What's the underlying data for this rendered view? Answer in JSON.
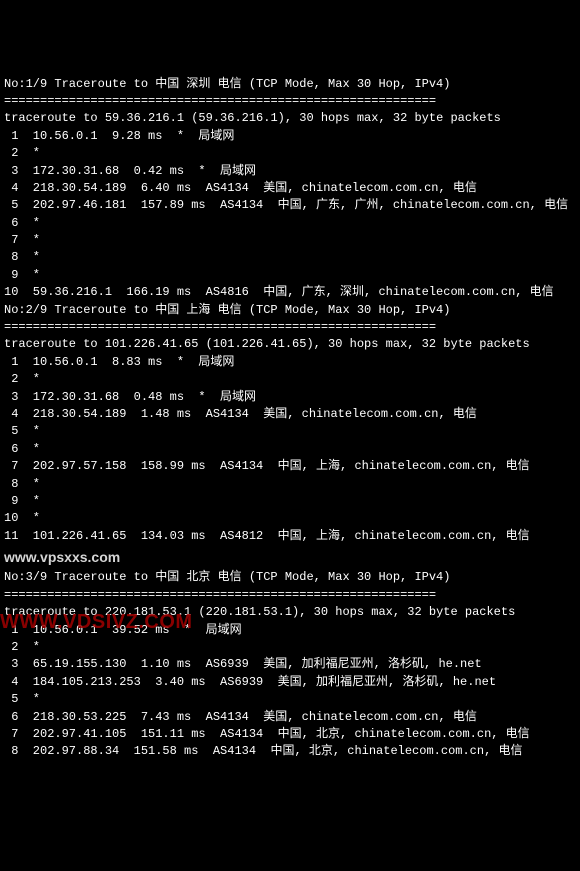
{
  "sep": "============================================================",
  "watermark1": "www.vpsxxs.com",
  "watermark2": "WWW.VDSIVZ.COM",
  "traces": [
    {
      "title": "No:1/9 Traceroute to 中国 深圳 电信 (TCP Mode, Max 30 Hop, IPv4)",
      "header": "traceroute to 59.36.216.1 (59.36.216.1), 30 hops max, 32 byte packets",
      "hops": [
        " 1  10.56.0.1  9.28 ms  *  局域网",
        " 2  *",
        " 3  172.30.31.68  0.42 ms  *  局域网",
        " 4  218.30.54.189  6.40 ms  AS4134  美国, chinatelecom.com.cn, 电信",
        " 5  202.97.46.181  157.89 ms  AS4134  中国, 广东, 广州, chinatelecom.com.cn, 电信",
        " 6  *",
        " 7  *",
        " 8  *",
        " 9  *",
        "10  59.36.216.1  166.19 ms  AS4816  中国, 广东, 深圳, chinatelecom.com.cn, 电信"
      ]
    },
    {
      "title": "No:2/9 Traceroute to 中国 上海 电信 (TCP Mode, Max 30 Hop, IPv4)",
      "header": "traceroute to 101.226.41.65 (101.226.41.65), 30 hops max, 32 byte packets",
      "hops": [
        " 1  10.56.0.1  8.83 ms  *  局域网",
        " 2  *",
        " 3  172.30.31.68  0.48 ms  *  局域网",
        " 4  218.30.54.189  1.48 ms  AS4134  美国, chinatelecom.com.cn, 电信",
        " 5  *",
        " 6  *",
        " 7  202.97.57.158  158.99 ms  AS4134  中国, 上海, chinatelecom.com.cn, 电信",
        " 8  *",
        " 9  *",
        "10  *",
        "11  101.226.41.65  134.03 ms  AS4812  中国, 上海, chinatelecom.com.cn, 电信"
      ]
    },
    {
      "title": "No:3/9 Traceroute to 中国 北京 电信 (TCP Mode, Max 30 Hop, IPv4)",
      "header": "traceroute to 220.181.53.1 (220.181.53.1), 30 hops max, 32 byte packets",
      "hops": [
        " 1  10.56.0.1  39.52 ms  *  局域网",
        " 2  *",
        " 3  65.19.155.130  1.10 ms  AS6939  美国, 加利福尼亚州, 洛杉矶, he.net",
        " 4  184.105.213.253  3.40 ms  AS6939  美国, 加利福尼亚州, 洛杉矶, he.net",
        " 5  *",
        " 6  218.30.53.225  7.43 ms  AS4134  美国, chinatelecom.com.cn, 电信",
        " 7  202.97.41.105  151.11 ms  AS4134  中国, 北京, chinatelecom.com.cn, 电信",
        " 8  202.97.88.34  151.58 ms  AS4134  中国, 北京, chinatelecom.com.cn, 电信"
      ]
    }
  ]
}
